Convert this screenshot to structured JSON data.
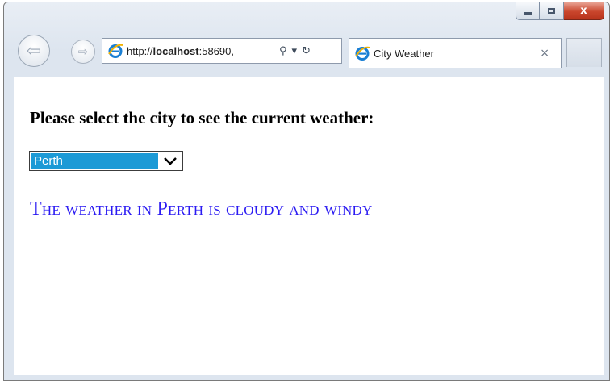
{
  "browser": {
    "address": {
      "url_prefix": "http://",
      "url_host": "localhost",
      "url_rest": ":58690,",
      "search_glyph": "⚲",
      "dropdown_glyph": "▾",
      "refresh_glyph": "↻"
    },
    "tab": {
      "title": "City Weather",
      "close_glyph": "×"
    },
    "caption": {
      "close_glyph": "x"
    }
  },
  "page": {
    "heading": "Please select the city to see the current weather:",
    "city_select": {
      "selected": "Perth"
    },
    "weather_message": "The weather in Perth is cloudy and windy"
  },
  "colors": {
    "selection_highlight": "#1c9ad6",
    "message_text": "#2b1bf2",
    "close_button": "#c9452c"
  },
  "icons": [
    "back-arrow-icon",
    "forward-arrow-icon",
    "ie-logo-icon",
    "search-icon",
    "dropdown-icon",
    "refresh-icon",
    "close-icon",
    "minimize-icon",
    "maximize-icon",
    "chevron-down-icon"
  ]
}
